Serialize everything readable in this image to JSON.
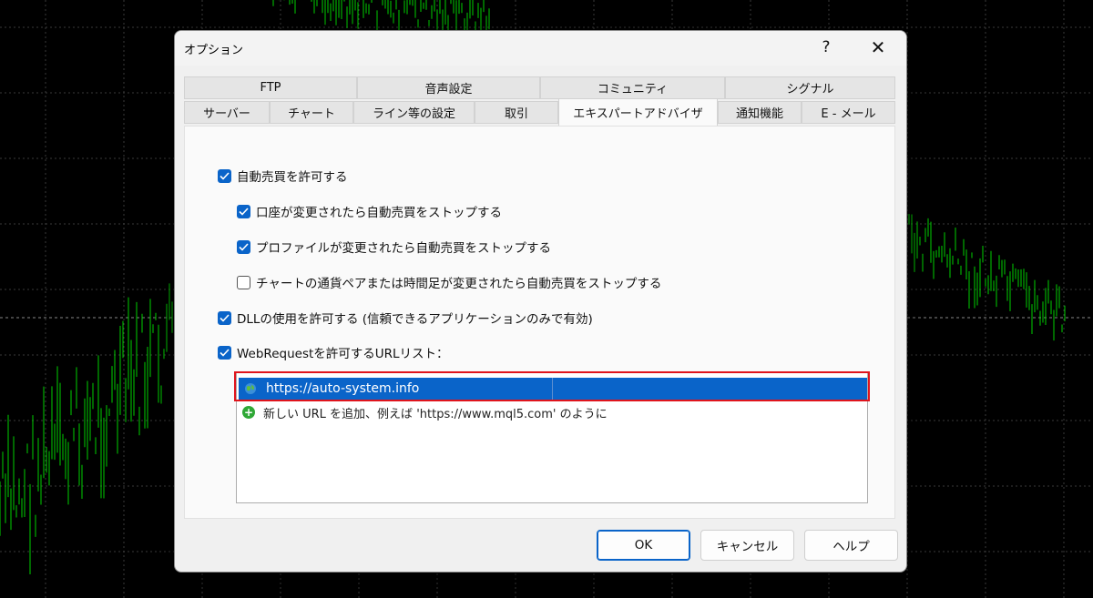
{
  "colors": {
    "chart_bg": "#000000",
    "candle": "#00d000",
    "grid": "#3a3a3a",
    "accent": "#0a64c9",
    "highlight": "#e0141c"
  },
  "dialog": {
    "title": "オプション",
    "help_label": "?",
    "close_label": "✕",
    "tabs_row1": [
      "FTP",
      "音声設定",
      "コミュニティ",
      "シグナル"
    ],
    "tabs_row2": [
      "サーバー",
      "チャート",
      "ライン等の設定",
      "取引",
      "エキスパートアドバイザ",
      "通知機能",
      "E - メール"
    ],
    "active_tab": "エキスパートアドバイザ",
    "options": [
      {
        "label": "自動売買を許可する",
        "checked": true
      },
      {
        "label": "口座が変更されたら自動売買をストップする",
        "checked": true
      },
      {
        "label": "プロファイルが変更されたら自動売買をストップする",
        "checked": true
      },
      {
        "label": "チャートの通貨ペアまたは時間足が変更されたら自動売買をストップする",
        "checked": false
      },
      {
        "label": "DLLの使用を許可する (信頼できるアプリケーションのみで有効)",
        "checked": true
      },
      {
        "label": "WebRequestを許可するURLリスト：",
        "checked": true
      }
    ],
    "url_list": {
      "selected_url": "https://auto-system.info",
      "add_hint": "新しい URL を追加、例えば 'https://www.mql5.com' のように"
    },
    "buttons": {
      "ok": "OK",
      "cancel": "キャンセル",
      "help": "ヘルプ"
    }
  }
}
